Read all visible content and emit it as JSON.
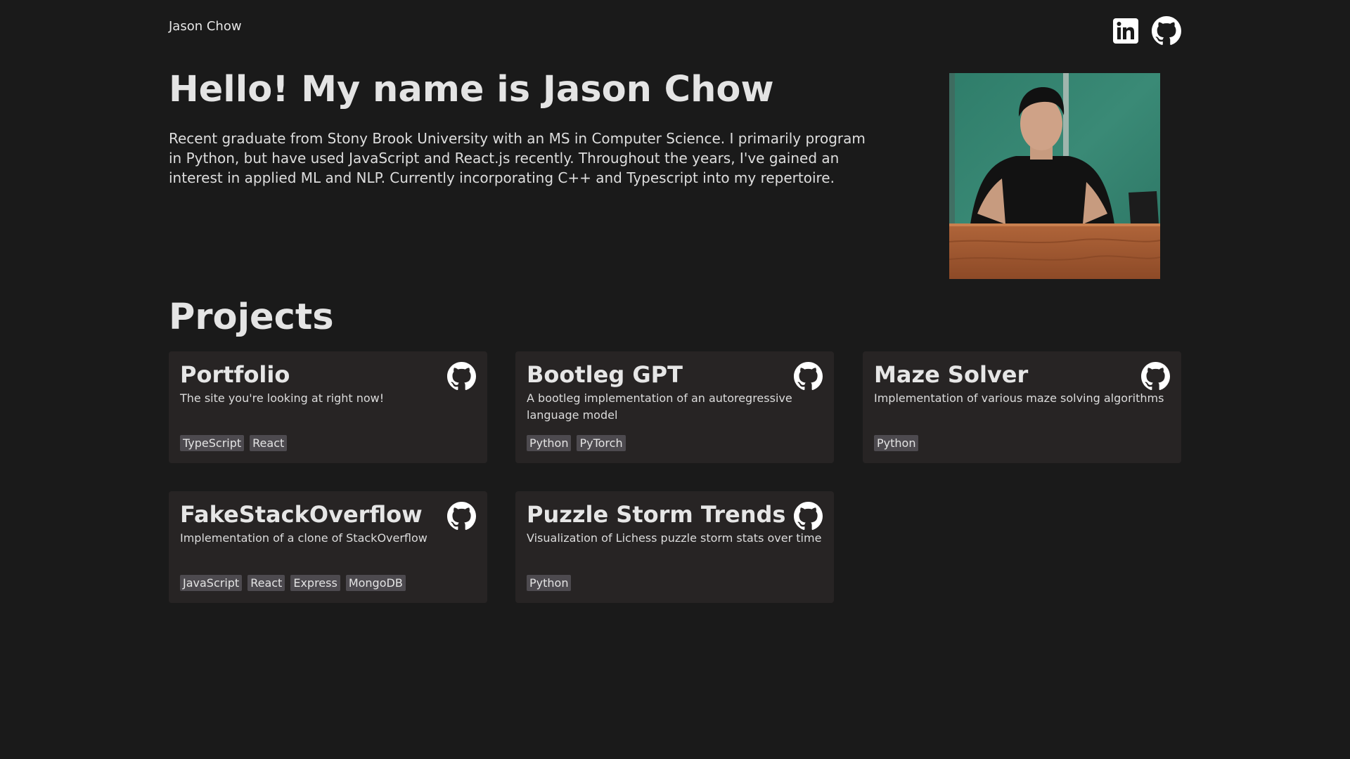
{
  "header": {
    "brand": "Jason Chow",
    "linkedin_icon": "linkedin-icon",
    "github_icon": "github-icon"
  },
  "hero": {
    "title": "Hello! My name is Jason Chow",
    "bio": "Recent graduate from Stony Brook University with an MS in Computer Science. I primarily program in Python, but have used JavaScript and React.js recently. Throughout the years, I've gained an interest in applied ML and NLP. Currently incorporating C++ and Typescript into my repertoire.",
    "photo_icon": "profile-photo"
  },
  "projects": {
    "title": "Projects",
    "items": [
      {
        "title": "Portfolio",
        "description": "The site you're looking at right now!",
        "tags": [
          "TypeScript",
          "React"
        ]
      },
      {
        "title": "Bootleg GPT",
        "description": "A bootleg implementation of an autoregressive language model",
        "tags": [
          "Python",
          "PyTorch"
        ]
      },
      {
        "title": "Maze Solver",
        "description": "Implementation of various maze solving algorithms",
        "tags": [
          "Python"
        ]
      },
      {
        "title": "FakeStackOverflow",
        "description": "Implementation of a clone of StackOverflow",
        "tags": [
          "JavaScript",
          "React",
          "Express",
          "MongoDB"
        ]
      },
      {
        "title": "Puzzle Storm Trends",
        "description": "Visualization of Lichess puzzle storm stats over time",
        "tags": [
          "Python"
        ]
      }
    ]
  },
  "colors": {
    "background": "#1a1a1a",
    "card": "#272424",
    "tag": "#4d4a4f",
    "text": "#e0e0e0"
  }
}
